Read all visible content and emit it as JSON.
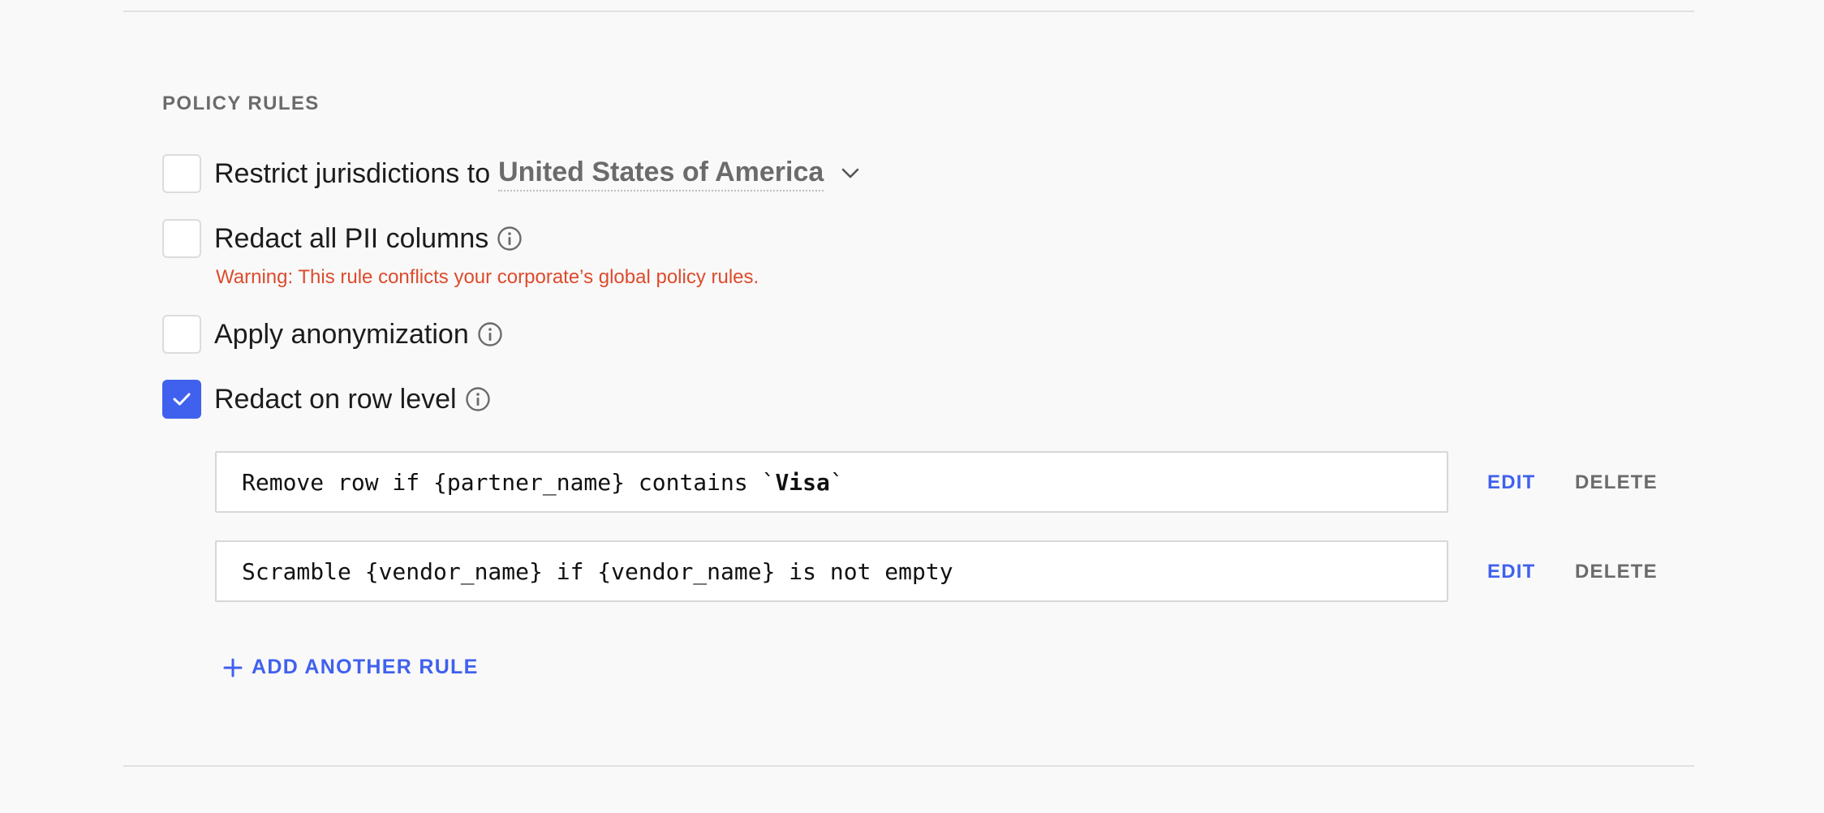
{
  "section": {
    "title": "POLICY RULES"
  },
  "rules": [
    {
      "label": "Restrict jurisdictions to",
      "checked": false,
      "jurisdiction": "United States of America"
    },
    {
      "label": "Redact all PII columns",
      "checked": false,
      "warning": "Warning: This rule conflicts your corporate’s global policy rules."
    },
    {
      "label": "Apply anonymization",
      "checked": false
    },
    {
      "label": "Redact on row level",
      "checked": true
    }
  ],
  "row_rules": [
    {
      "prefix": "Remove row if {partner_name} contains `",
      "highlight": "Visa",
      "suffix": "`",
      "edit_label": "EDIT",
      "delete_label": "DELETE"
    },
    {
      "prefix": "Scramble {vendor_name} if {vendor_name} is not empty",
      "highlight": "",
      "suffix": "",
      "edit_label": "EDIT",
      "delete_label": "DELETE"
    }
  ],
  "add_rule": {
    "label": "ADD ANOTHER RULE"
  },
  "icons": {
    "checkmark": "check-icon",
    "info": "info-icon",
    "chevron": "chevron-down-icon",
    "plus": "plus-icon"
  },
  "colors": {
    "accent": "#4061ee",
    "warning": "#dd4b2c",
    "muted": "#6b6b6b"
  }
}
